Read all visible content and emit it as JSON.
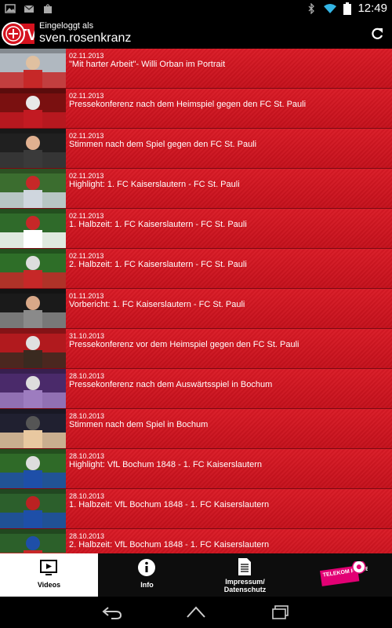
{
  "status": {
    "time": "12:49"
  },
  "header": {
    "login_label": "Eingeloggt als",
    "username": "sven.rosenkranz",
    "logo_text": "TV"
  },
  "videos": [
    {
      "date": "02.11.2013",
      "title": "\"Mit harter Arbeit\"- Willi Orban im Portrait"
    },
    {
      "date": "02.11.2013",
      "title": "Pressekonferenz nach dem Heimspiel gegen den FC St. Pauli"
    },
    {
      "date": "02.11.2013",
      "title": "Stimmen nach dem Spiel gegen den FC St. Pauli"
    },
    {
      "date": "02.11.2013",
      "title": "Highlight: 1. FC Kaiserslautern - FC St. Pauli"
    },
    {
      "date": "02.11.2013",
      "title": "1. Halbzeit: 1. FC Kaiserslautern - FC St. Pauli"
    },
    {
      "date": "02.11.2013",
      "title": "2. Halbzeit: 1. FC Kaiserslautern - FC St. Pauli"
    },
    {
      "date": "01.11.2013",
      "title": "Vorbericht: 1. FC Kaiserslautern - FC St. Pauli"
    },
    {
      "date": "31.10.2013",
      "title": "Pressekonferenz vor dem Heimspiel gegen den FC St. Pauli"
    },
    {
      "date": "28.10.2013",
      "title": "Pressekonferenz nach dem Auswärtsspiel in Bochum"
    },
    {
      "date": "28.10.2013",
      "title": "Stimmen nach dem Spiel in Bochum"
    },
    {
      "date": "28.10.2013",
      "title": "Highlight: VfL Bochum 1848 - 1. FC Kaiserslautern"
    },
    {
      "date": "28.10.2013",
      "title": "1. Halbzeit: VfL Bochum 1848 - 1. FC Kaiserslautern"
    },
    {
      "date": "28.10.2013",
      "title": "2. Halbzeit: VfL Bochum 1848 - 1. FC Kaiserslautern"
    }
  ],
  "tabs": [
    {
      "label": "Videos",
      "icon": "video-icon",
      "active": true
    },
    {
      "label": "Info",
      "icon": "info-icon",
      "active": false
    },
    {
      "label": "Impressum/ Datenschutz",
      "icon": "document-icon",
      "active": false
    },
    {
      "label": "TELEKOM FUSSBALL",
      "icon": "telekom-fussball-logo",
      "active": false
    }
  ],
  "colors": {
    "list_red": "#d5121e",
    "brand_magenta": "#e20074"
  }
}
